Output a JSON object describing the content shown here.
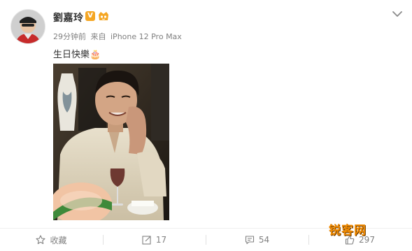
{
  "post": {
    "username": "劉嘉玲",
    "verified_badge": "V",
    "time": "29分钟前",
    "source_prefix": "来自",
    "source_device": "iPhone 12 Pro Max",
    "text": "生日快樂🎂",
    "menu_icon": "chevron-down-icon",
    "avatar_icon": "avatar",
    "photo_icon": "post-photo"
  },
  "actions": [
    {
      "label": "收藏",
      "icon": "star-icon"
    },
    {
      "label": "17",
      "icon": "share-icon"
    },
    {
      "label": "54",
      "icon": "comment-icon"
    },
    {
      "label": "297",
      "icon": "like-icon"
    }
  ],
  "watermark": {
    "text": "锐客网"
  },
  "colors": {
    "meta_gray": "#808080",
    "vip_orange": "#f5a623",
    "watermark_orange": "#f08a00"
  }
}
